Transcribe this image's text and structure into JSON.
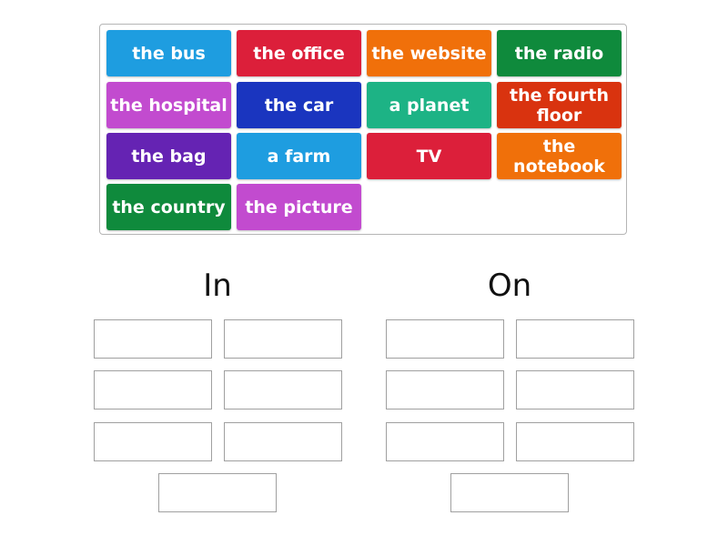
{
  "tiles": [
    {
      "label": "the bus",
      "color": "#1e9de0"
    },
    {
      "label": "the office",
      "color": "#dc1f3a"
    },
    {
      "label": "the website",
      "color": "#f0700a"
    },
    {
      "label": "the radio",
      "color": "#0f8a3c"
    },
    {
      "label": "the hospital",
      "color": "#c24bcf"
    },
    {
      "label": "the car",
      "color": "#1a35bf"
    },
    {
      "label": "a planet",
      "color": "#1db385"
    },
    {
      "label": "the fourth floor",
      "color": "#d9330f"
    },
    {
      "label": "the bag",
      "color": "#6523b3"
    },
    {
      "label": "a farm",
      "color": "#1e9de0"
    },
    {
      "label": "TV",
      "color": "#dc1f3a"
    },
    {
      "label": "the notebook",
      "color": "#f0700a"
    },
    {
      "label": "the country",
      "color": "#0f8a3c"
    },
    {
      "label": "the picture",
      "color": "#c24bcf"
    }
  ],
  "groups": [
    {
      "title": "In",
      "slot_count": 7
    },
    {
      "title": "On",
      "slot_count": 7
    }
  ]
}
